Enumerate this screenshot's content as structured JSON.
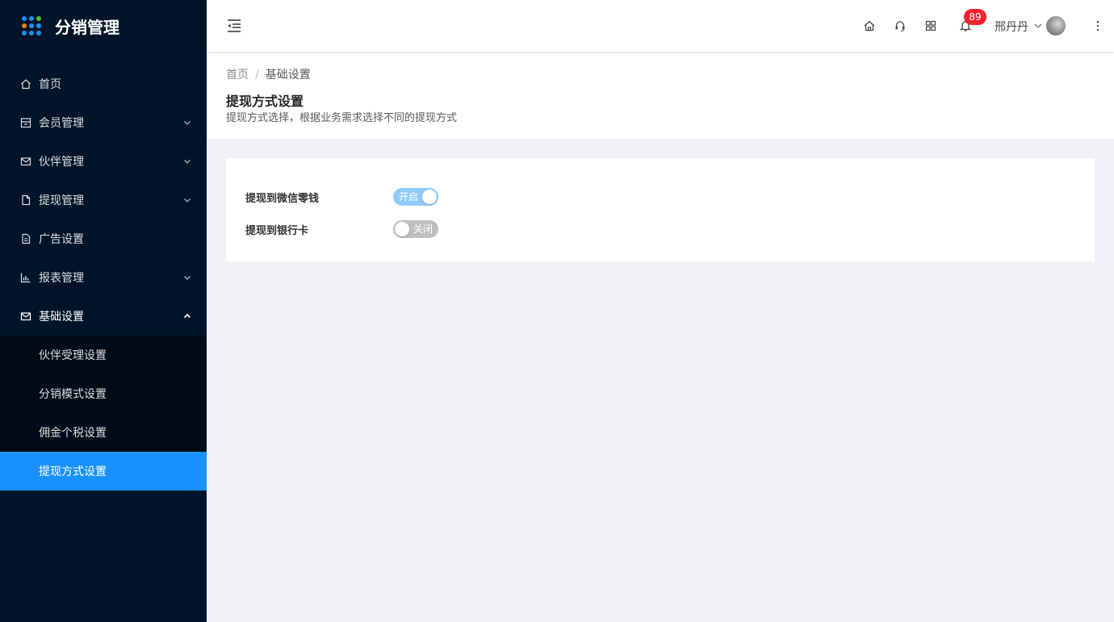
{
  "app": {
    "title": "分销管理"
  },
  "colors": {
    "sidebar_bg": "#001529",
    "accent": "#1890ff",
    "badge": "#f5222d"
  },
  "logo_dots": [
    "#1890ff",
    "#1890ff",
    "#52c41a",
    "#ff7a00",
    "#1890ff",
    "#1890ff",
    "#1890ff",
    "#1890ff",
    "#1890ff"
  ],
  "sidebar": {
    "items": [
      {
        "label": "首页",
        "icon": "home-icon"
      },
      {
        "label": "会员管理",
        "icon": "member-icon"
      },
      {
        "label": "伙伴管理",
        "icon": "mail-icon"
      },
      {
        "label": "提现管理",
        "icon": "file-icon"
      },
      {
        "label": "广告设置",
        "icon": "file-text-icon"
      },
      {
        "label": "报表管理",
        "icon": "bar-chart-icon"
      },
      {
        "label": "基础设置",
        "icon": "mail-icon"
      }
    ],
    "submenu": [
      {
        "label": "伙伴受理设置"
      },
      {
        "label": "分销模式设置"
      },
      {
        "label": "佣金个税设置"
      },
      {
        "label": "提现方式设置"
      }
    ]
  },
  "header": {
    "notification_count": "89",
    "user_name": "邢丹丹"
  },
  "breadcrumb": {
    "home": "首页",
    "current": "基础设置"
  },
  "page": {
    "title": "提现方式设置",
    "description": "提现方式选择，根据业务需求选择不同的提现方式"
  },
  "form": {
    "rows": [
      {
        "label": "提现到微信零钱",
        "switch_label": "开启",
        "enabled": true
      },
      {
        "label": "提现到银行卡",
        "switch_label": "关闭",
        "enabled": false
      }
    ]
  }
}
